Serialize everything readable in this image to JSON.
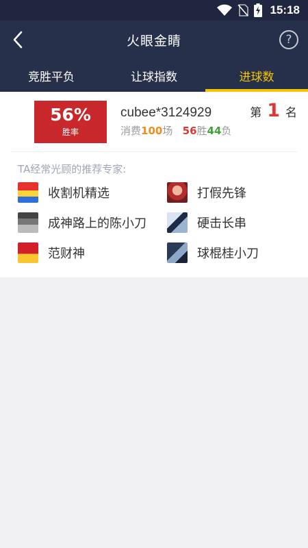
{
  "status_bar": {
    "time": "15:18"
  },
  "app_bar": {
    "title": "火眼金睛",
    "back_icon": "back-chevron-icon",
    "help_symbol": "?"
  },
  "tabs": [
    {
      "label": "竞胜平负",
      "active": false
    },
    {
      "label": "让球指数",
      "active": false
    },
    {
      "label": "进球数",
      "active": true
    }
  ],
  "summary": {
    "win_rate": "56%",
    "win_rate_label": "胜率",
    "username": "cubee*3124929",
    "consume_prefix": "消费",
    "consume_count": "100",
    "consume_suffix": "场",
    "wins": "56",
    "wins_label": "胜",
    "losses": "44",
    "losses_label": "负",
    "rank_prefix": "第",
    "rank": "1",
    "rank_suffix": "名"
  },
  "experts_heading": "TA经常光顾的推荐专家:",
  "experts": [
    {
      "name": "收割机精选"
    },
    {
      "name": "打假先锋"
    },
    {
      "name": "成神路上的陈小刀"
    },
    {
      "name": "硬击长串"
    },
    {
      "name": "范财神"
    },
    {
      "name": "球棍桂小刀"
    }
  ],
  "colors": {
    "header_bg": "#27304b",
    "accent": "#f5c400",
    "rate_bg": "#c8282c"
  }
}
